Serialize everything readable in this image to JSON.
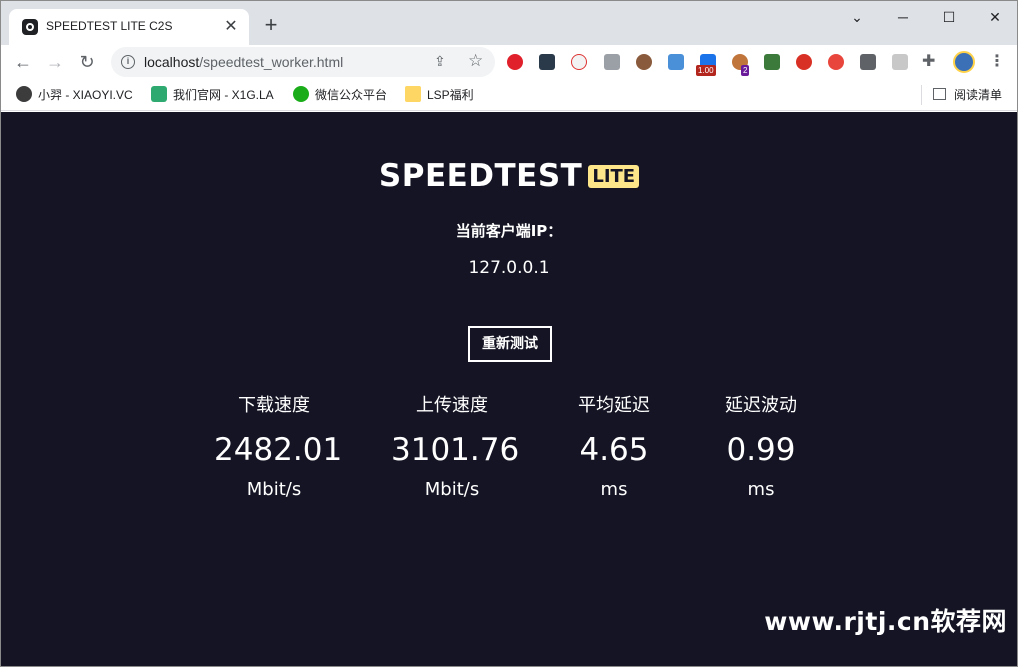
{
  "browser": {
    "tab_title": "SPEEDTEST LITE C2S",
    "url_host": "localhost",
    "url_path": "/speedtest_worker.html",
    "ext_badges": [
      "1.00",
      "2"
    ],
    "bookmarks": [
      {
        "label": "小羿 - XIAOYI.VC"
      },
      {
        "label": "我们官网 - X1G.LA"
      },
      {
        "label": "微信公众平台"
      },
      {
        "label": "LSP福利"
      }
    ],
    "reading_list": "阅读清单"
  },
  "speedtest": {
    "logo_main": "SPEEDTEST",
    "logo_badge": "LITE",
    "ip_label": "当前客户端IP：",
    "ip_value": "127.0.0.1",
    "retest_label": "重新测试",
    "metrics": [
      {
        "label": "下载速度",
        "value": "2482.01",
        "unit": "Mbit/s"
      },
      {
        "label": "上传速度",
        "value": "3101.76",
        "unit": "Mbit/s"
      },
      {
        "label": "平均延迟",
        "value": "4.65",
        "unit": "ms"
      },
      {
        "label": "延迟波动",
        "value": "0.99",
        "unit": "ms"
      }
    ]
  },
  "watermark": "www.rjtj.cn软荐网",
  "colors": {
    "page_bg": "#141424",
    "badge_bg": "#fde68a",
    "tabstrip_bg": "#dee1e6"
  }
}
